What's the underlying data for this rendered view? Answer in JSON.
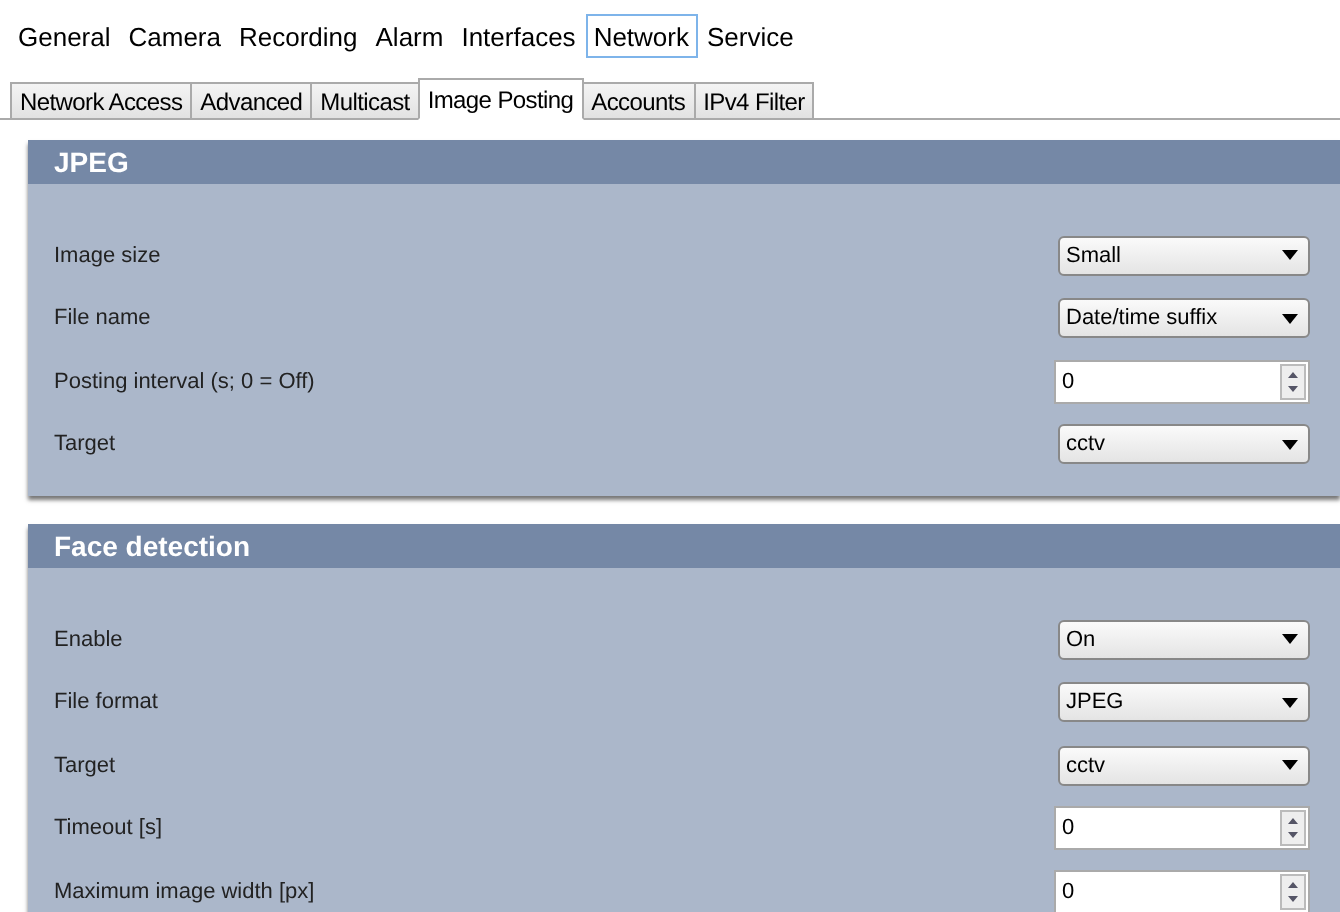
{
  "menu": [
    {
      "label": "General",
      "selected": false
    },
    {
      "label": "Camera",
      "selected": false
    },
    {
      "label": "Recording",
      "selected": false
    },
    {
      "label": "Alarm",
      "selected": false
    },
    {
      "label": "Interfaces",
      "selected": false
    },
    {
      "label": "Network",
      "selected": true
    },
    {
      "label": "Service",
      "selected": false
    }
  ],
  "tabs": [
    {
      "label": "Network Access",
      "selected": false
    },
    {
      "label": "Advanced",
      "selected": false
    },
    {
      "label": "Multicast",
      "selected": false
    },
    {
      "label": "Image Posting",
      "selected": true
    },
    {
      "label": "Accounts",
      "selected": false
    },
    {
      "label": "IPv4 Filter",
      "selected": false
    }
  ],
  "sections": [
    {
      "title": "JPEG",
      "rows": [
        {
          "label": "Image size",
          "kind": "select",
          "value": "Small"
        },
        {
          "label": "File name",
          "kind": "select",
          "value": "Date/time suffix"
        },
        {
          "label": "Posting interval (s; 0 = Off)",
          "kind": "spin",
          "value": "0"
        },
        {
          "label": "Target",
          "kind": "select",
          "value": "cctv"
        }
      ]
    },
    {
      "title": "Face detection",
      "rows": [
        {
          "label": "Enable",
          "kind": "select",
          "value": "On"
        },
        {
          "label": "File format",
          "kind": "select",
          "value": "JPEG"
        },
        {
          "label": "Target",
          "kind": "select",
          "value": "cctv"
        },
        {
          "label": "Timeout [s]",
          "kind": "spin",
          "value": "0"
        },
        {
          "label": "Maximum image width [px]",
          "kind": "spin",
          "value": "0"
        }
      ]
    }
  ]
}
